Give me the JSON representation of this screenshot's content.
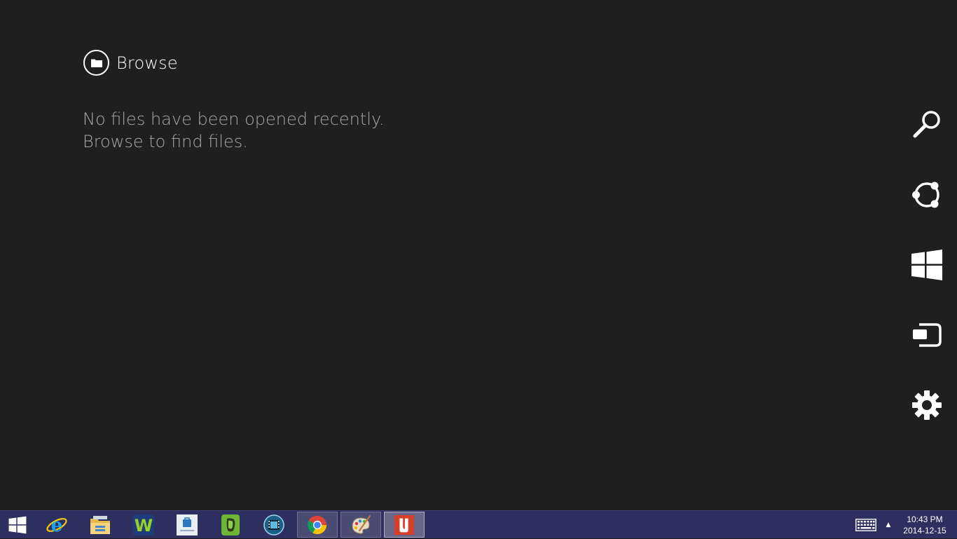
{
  "browse": {
    "label": "Browse"
  },
  "empty_state": {
    "line1": "No files have been opened recently.",
    "line2": "Browse to find files."
  },
  "charms": [
    {
      "name": "search",
      "icon": "search-icon"
    },
    {
      "name": "share",
      "icon": "share-icon"
    },
    {
      "name": "start",
      "icon": "windows-logo-icon"
    },
    {
      "name": "devices",
      "icon": "devices-icon"
    },
    {
      "name": "settings",
      "icon": "gear-icon"
    }
  ],
  "taskbar": {
    "apps": [
      {
        "name": "Internet Explorer",
        "icon": "internet-explorer-icon",
        "state": "pinned"
      },
      {
        "name": "File Explorer",
        "icon": "file-explorer-icon",
        "state": "pinned"
      },
      {
        "name": "W app",
        "icon": "w-app-icon",
        "state": "pinned"
      },
      {
        "name": "Store app",
        "icon": "store-app-icon",
        "state": "pinned"
      },
      {
        "name": "Evernote",
        "icon": "evernote-icon",
        "state": "pinned"
      },
      {
        "name": "Video app",
        "icon": "film-reel-icon",
        "state": "pinned"
      },
      {
        "name": "Google Chrome",
        "icon": "chrome-icon",
        "state": "running"
      },
      {
        "name": "Paint",
        "icon": "paint-palette-icon",
        "state": "running"
      },
      {
        "name": "PDF app",
        "icon": "pdf-app-icon",
        "state": "active"
      }
    ],
    "clock": {
      "time": "10:43 PM",
      "date": "2014-12-15"
    }
  },
  "colors": {
    "background": "#1f1f1f",
    "taskbar": "#2d2f5e",
    "muted_text": "#a8a8a8"
  }
}
